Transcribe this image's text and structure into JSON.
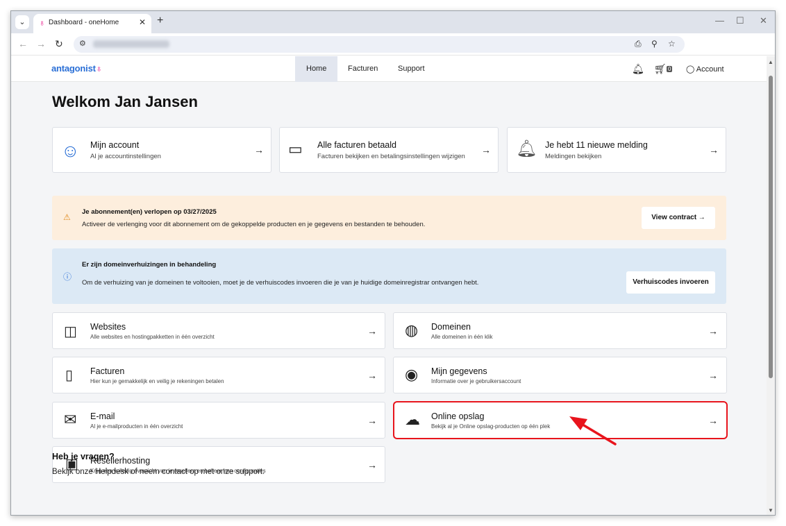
{
  "browser": {
    "tab_title": "Dashboard - oneHome",
    "tab_menu_icon": "chevron-down-icon",
    "new_tab": "+",
    "tab_close": "✕"
  },
  "header": {
    "logo": "antagonist",
    "nav": [
      "Home",
      "Facturen",
      "Support"
    ],
    "cart_count": "0",
    "account_label": "Account"
  },
  "page": {
    "welcome": "Welkom Jan Jansen"
  },
  "top_cards": [
    {
      "title": "Mijn account",
      "subtitle": "Al je accountinstellingen",
      "icon": "smiley-icon"
    },
    {
      "title": "Alle facturen betaald",
      "subtitle": "Facturen bekijken en betalingsinstellingen wijzigen",
      "icon": "credit-card-icon"
    },
    {
      "title": "Je hebt 11 nieuwe melding",
      "subtitle": "Meldingen bekijken",
      "icon": "bell-alert-icon"
    }
  ],
  "alerts": {
    "warning": {
      "title": "Je abonnement(en) verlopen op 03/27/2025",
      "text": "Activeer de verlenging voor dit abonnement om de gekoppelde producten en je gegevens en bestanden te behouden.",
      "button": "View contract",
      "bg": "#fdeedd"
    },
    "info": {
      "title": "Er zijn domeinverhuizingen in behandeling",
      "text": "Om de verhuizing van je domeinen te voltooien, moet je de verhuiscodes invoeren die je van je huidige domeinregistrar ontvangen hebt.",
      "button": "Verhuiscodes invoeren",
      "bg": "#dce9f5"
    }
  },
  "services": [
    {
      "title": "Websites",
      "subtitle": "Alle websites en hostingpakketten in één overzicht",
      "icon": "website-icon"
    },
    {
      "title": "Domeinen",
      "subtitle": "Alle domeinen in één klik",
      "icon": "globe-icon"
    },
    {
      "title": "Facturen",
      "subtitle": "Hier kun je gemakkelijk en veilig je rekeningen betalen",
      "icon": "document-icon"
    },
    {
      "title": "Mijn gegevens",
      "subtitle": "Informatie over je gebruikersaccount",
      "icon": "user-circle-icon"
    },
    {
      "title": "E-mail",
      "subtitle": "Al je e-mailproducten in één overzicht",
      "icon": "envelope-icon"
    },
    {
      "title": "Online opslag",
      "subtitle": "Bekijk al je Online opslag-producten op één plek",
      "icon": "cloud-upload-icon"
    },
    {
      "title": "Resellerhosting",
      "subtitle": "Krijg een volledig overzicht van je resellers en beheer hun configuraties",
      "icon": "reseller-icon"
    }
  ],
  "faq": {
    "title": "Heb je vragen?",
    "text": "Bekijk onze Helpdesk of neem contact op met onze support."
  },
  "colors": {
    "highlight": "#e8141c",
    "brand_pink": "#e6007e",
    "brand_blue": "#2a6fd6"
  }
}
